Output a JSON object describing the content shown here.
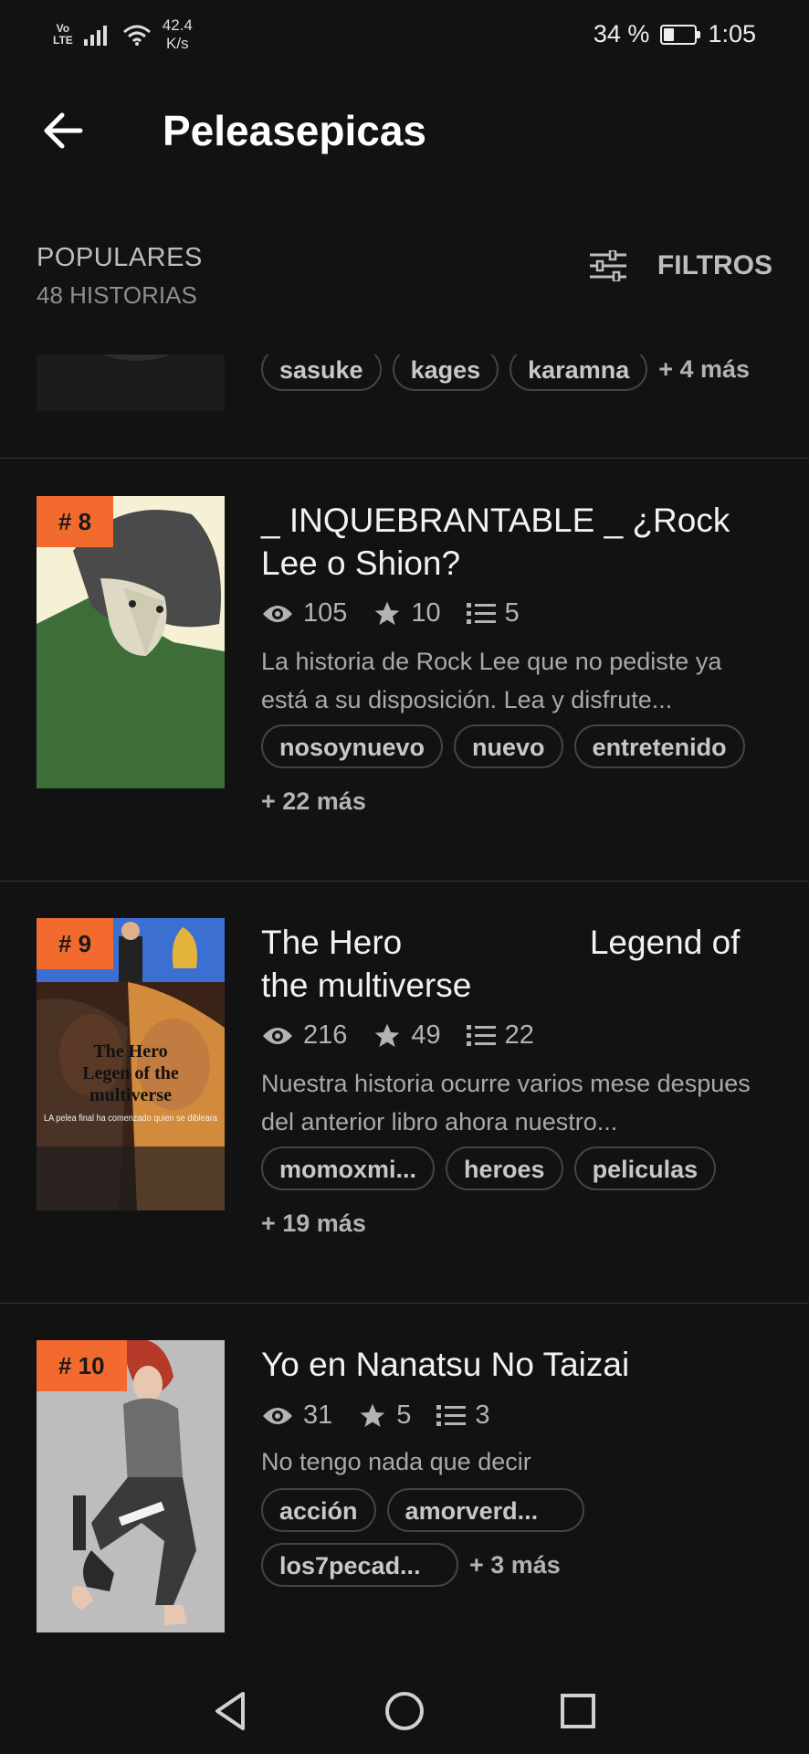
{
  "status_bar": {
    "network_top": "Vo",
    "network_bottom": "LTE",
    "speed_value": "42.4",
    "speed_unit": "K/s",
    "battery": "34 %",
    "battery_level": 0.34,
    "time": "1:05"
  },
  "app_bar": {
    "title": "Peleasepicas"
  },
  "sort": {
    "label": "POPULARES",
    "count": "48 HISTORIAS",
    "filters_label": "FILTROS"
  },
  "partial_item": {
    "tags": [
      "sasuke",
      "kages",
      "karamna"
    ],
    "more": "+ 4 más"
  },
  "stories": [
    {
      "rank": "# 8",
      "title": "_ INQUEBRANTABLE _ ¿Rock Lee o Shion?",
      "views": "105",
      "votes": "10",
      "parts": "5",
      "description": "La historia de Rock Lee que no pediste ya está a su disposición. Lea y disfrute...",
      "tags": [
        "nosoynuevo",
        "nuevo",
        "entretenido"
      ],
      "more": "+ 22 más"
    },
    {
      "rank": "# 9",
      "title": "The Hero                    Legend of the multiverse",
      "views": "216",
      "votes": "49",
      "parts": "22",
      "description": "Nuestra historia ocurre varios mese despues del anterior libro ahora nuestro...",
      "tags": [
        "momoxmi...",
        "heroes",
        "peliculas"
      ],
      "more": "+ 19 más",
      "cover_text": {
        "line1": "The Hero",
        "line2": "Legen of the",
        "line3": "multiverse",
        "small": "LA pelea final ha comenzado quien se dibleara"
      }
    },
    {
      "rank": "# 10",
      "title": "Yo en Nanatsu No Taizai",
      "views": "31",
      "votes": "5",
      "parts": "3",
      "description": "No tengo nada que decir",
      "tags": [
        "acción",
        "amorverd...",
        "los7pecad..."
      ],
      "more": "+ 3 más"
    }
  ],
  "colors": {
    "background": "#121212",
    "rank_badge": "#f26a2e",
    "divider": "#333333"
  },
  "icons": [
    "back-arrow-icon",
    "filter-sliders-icon",
    "eye-icon",
    "star-icon",
    "list-icon",
    "nav-back-icon",
    "nav-home-icon",
    "nav-recents-icon"
  ]
}
